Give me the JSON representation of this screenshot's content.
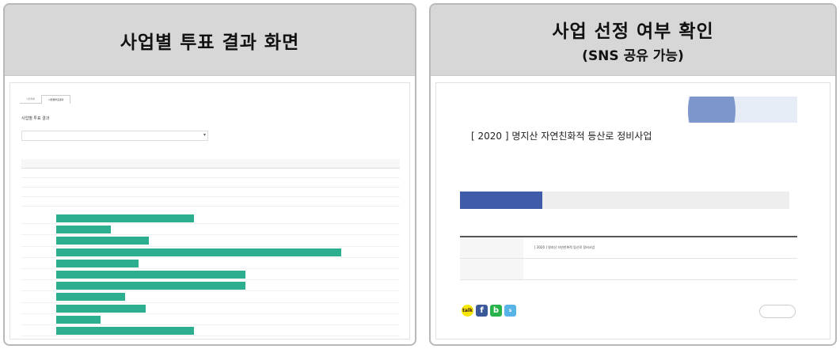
{
  "left_panel": {
    "title": "사업별 투표 결과 화면",
    "screenshot": {
      "tabs": [
        "사업목록",
        "사업별투표결과"
      ],
      "active_tab_index": 1,
      "section_title": "사업별 투표 결과",
      "section_note": "",
      "select_label": "",
      "select_value": "",
      "subheading": "",
      "table": {
        "headers": [
          "",
          "",
          "",
          "",
          "",
          "",
          "",
          "",
          "",
          "",
          "",
          "",
          "",
          "",
          "",
          "",
          "",
          "",
          ""
        ],
        "rows": [
          [
            "",
            "",
            "",
            "",
            "",
            "",
            "",
            "",
            "",
            "",
            "",
            "",
            "",
            "",
            "",
            "",
            "",
            "",
            ""
          ],
          [
            "",
            "",
            "",
            "",
            "",
            "",
            "",
            "",
            "",
            "",
            "",
            "",
            "",
            "",
            "",
            "",
            "",
            "",
            ""
          ],
          [
            "",
            "",
            "",
            "",
            "",
            "",
            "",
            "",
            "",
            "",
            "",
            "",
            "",
            "",
            "",
            "",
            "",
            "",
            ""
          ],
          [
            "",
            "",
            "",
            "",
            "",
            "",
            "",
            "",
            "",
            "",
            "",
            "",
            "",
            "",
            "",
            "",
            "",
            "",
            ""
          ]
        ]
      },
      "bars": [
        {
          "label": "",
          "value": 0.4
        },
        {
          "label": "",
          "value": 0.16
        },
        {
          "label": "",
          "value": 0.27
        },
        {
          "label": "",
          "value": 0.83
        },
        {
          "label": "",
          "value": 0.24
        },
        {
          "label": "",
          "value": 0.55
        },
        {
          "label": "",
          "value": 0.55
        },
        {
          "label": "",
          "value": 0.2
        },
        {
          "label": "",
          "value": 0.26
        },
        {
          "label": "",
          "value": 0.13
        },
        {
          "label": "",
          "value": 0.4
        }
      ],
      "bar_color": "#2cae8f"
    }
  },
  "right_panel": {
    "title": "사업 선정 여부 확인",
    "subtitle": "(SNS 공유 가능)",
    "screenshot": {
      "notice": "",
      "project_title": "[ 2020 ] 명지산 자연친화적 등산로 정비사업",
      "meta": "",
      "meta_right": "",
      "tabs": [
        "",
        "",
        "",
        ""
      ],
      "active_tab_index": 0,
      "detail_rows": [
        {
          "key": "",
          "value": "[ 2020 ] 명지산 자연친화적 등산로 정비사업"
        },
        {
          "key": "",
          "value": ""
        }
      ],
      "share_buttons": [
        {
          "name": "kakao",
          "icon": "kakao-icon",
          "glyph": "talk",
          "color": "#f7e600"
        },
        {
          "name": "facebook",
          "icon": "facebook-icon",
          "glyph": "f",
          "color": "#3b5998"
        },
        {
          "name": "band",
          "icon": "band-icon",
          "glyph": "b",
          "color": "#27b34a"
        },
        {
          "name": "kakaostory",
          "icon": "kakaostory-icon",
          "glyph": "s",
          "color": "#58b3e6"
        }
      ],
      "list_button": "",
      "accent_color": "#3f5ba9"
    }
  }
}
